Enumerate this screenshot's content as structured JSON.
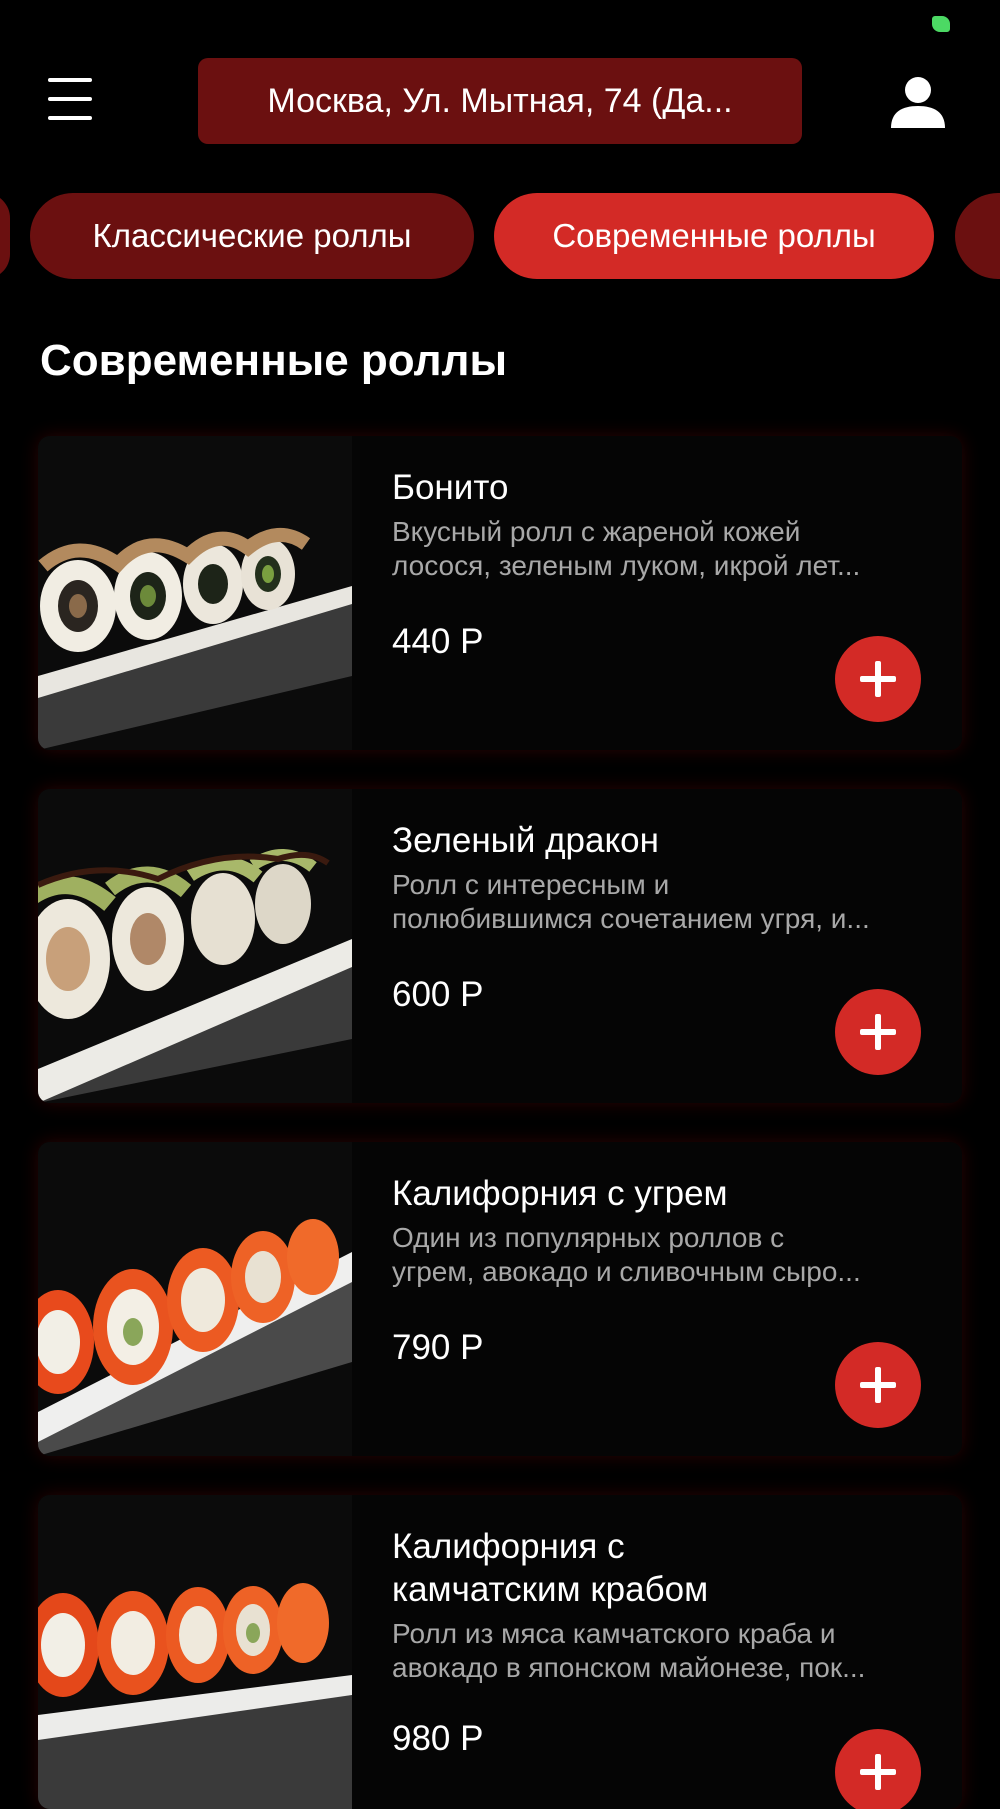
{
  "header": {
    "address": "Москва, Ул. Мытная, 74 (Да...",
    "menu_icon": "hamburger-menu-icon",
    "profile_icon": "user-icon"
  },
  "categories": [
    {
      "label": "Классические роллы",
      "active": false
    },
    {
      "label": "Современные роллы",
      "active": true
    }
  ],
  "section_title": "Современные роллы",
  "products": [
    {
      "name": "Бонито",
      "desc_line1": "Вкусный ролл с жареной кожей",
      "desc_line2": "лосося, зеленым луком, икрой лет...",
      "price": "440 Р"
    },
    {
      "name": "Зеленый дракон",
      "desc_line1": "Ролл с интересным и",
      "desc_line2": "полюбившимся сочетанием угря, и...",
      "price": "600 Р"
    },
    {
      "name": "Калифорния с угрем",
      "desc_line1": "Один из популярных роллов с",
      "desc_line2": "угрем, авокадо и сливочным сыро...",
      "price": "790 Р"
    },
    {
      "name_line1": "Калифорния с",
      "name_line2": "камчатским крабом",
      "desc_line1": "Ролл из мяса камчатского краба и",
      "desc_line2": "авокадо в японском майонезе, пок...",
      "price": "980 Р"
    }
  ],
  "colors": {
    "background": "#000000",
    "accent": "#d32a26",
    "accent_dark": "#6b1010",
    "muted_text": "#a8a8a8"
  }
}
